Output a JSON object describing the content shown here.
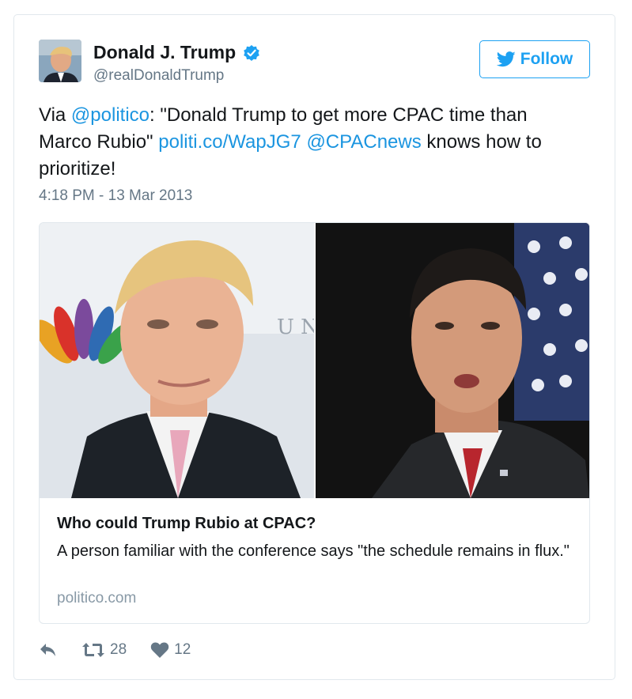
{
  "author": {
    "display_name": "Donald J. Trump",
    "handle": "@realDonaldTrump",
    "verified": true,
    "avatar_icon": "profile-photo"
  },
  "follow_button": {
    "label": "Follow",
    "icon": "twitter-bird-icon"
  },
  "tweet": {
    "segments": [
      {
        "text": "Via ",
        "link": false
      },
      {
        "text": "@politico",
        "link": true
      },
      {
        "text": ": \"Donald Trump to get more CPAC time than Marco Rubio\" ",
        "link": false
      },
      {
        "text": "politi.co/WapJG7",
        "link": true
      },
      {
        "text": " ",
        "link": false
      },
      {
        "text": "@CPACnews",
        "link": true
      },
      {
        "text": " knows how to prioritize!",
        "link": false
      }
    ],
    "timestamp": "4:18 PM - 13 Mar 2013"
  },
  "card": {
    "image": "photo of Donald Trump beside photo of Marco Rubio",
    "title": "Who could Trump Rubio at CPAC?",
    "description": "A person familiar with the conference says \"the schedule remains in flux.\"",
    "domain": "politico.com"
  },
  "actions": {
    "reply_icon": "reply-icon",
    "retweet_icon": "retweet-icon",
    "retweet_count": "28",
    "like_icon": "heart-icon",
    "like_count": "12"
  },
  "colors": {
    "link": "#1b95e0",
    "brand": "#1da1f2",
    "muted": "#657786",
    "border": "#e1e8ed"
  }
}
